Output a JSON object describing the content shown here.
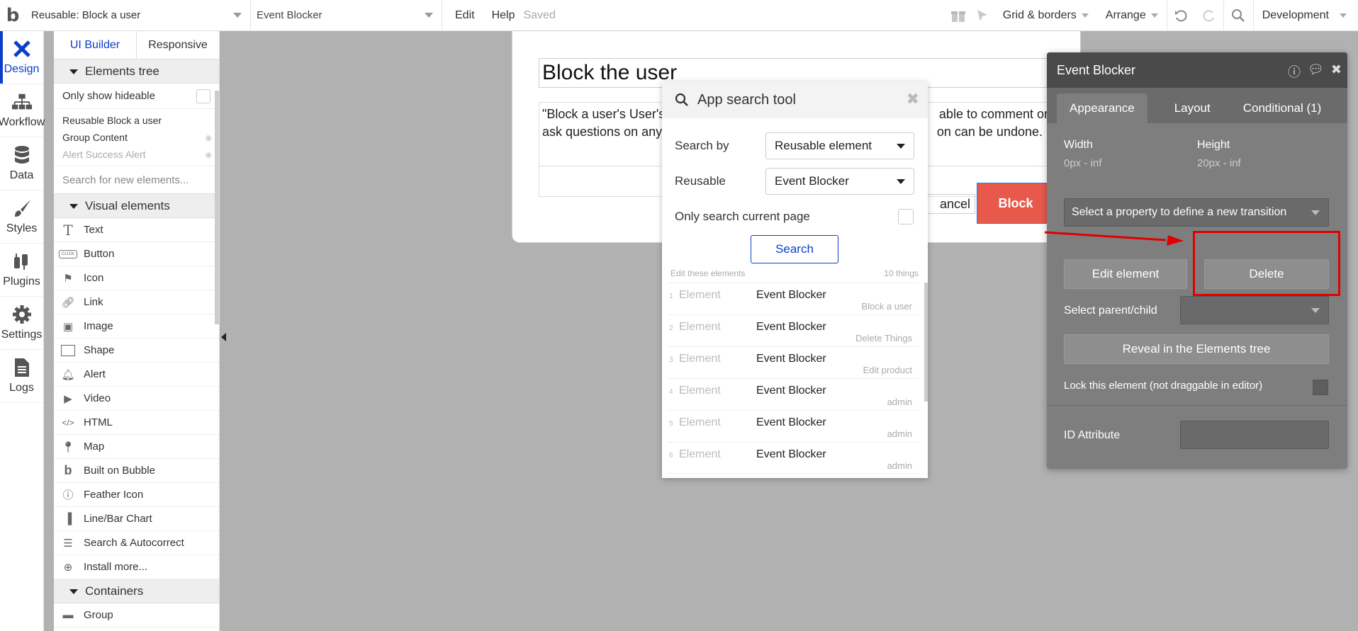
{
  "topbar": {
    "page_select": "Reusable: Block a user",
    "element_select": "Event Blocker",
    "edit": "Edit",
    "help": "Help",
    "saved": "Saved",
    "grid": "Grid & borders",
    "arrange": "Arrange",
    "env": "Development"
  },
  "rail": [
    {
      "label": "Design",
      "icon": "design-icon"
    },
    {
      "label": "Workflow",
      "icon": "workflow-icon"
    },
    {
      "label": "Data",
      "icon": "data-icon"
    },
    {
      "label": "Styles",
      "icon": "styles-icon"
    },
    {
      "label": "Plugins",
      "icon": "plugins-icon"
    },
    {
      "label": "Settings",
      "icon": "settings-icon"
    },
    {
      "label": "Logs",
      "icon": "logs-icon"
    }
  ],
  "panel": {
    "tabs": [
      "UI Builder",
      "Responsive"
    ],
    "tree_header": "Elements tree",
    "only_hideable": "Only show hideable",
    "tree": [
      "Reusable Block a user",
      "Group Content",
      "Alert Success Alert"
    ],
    "search_placeholder": "Search for new elements...",
    "visual_header": "Visual elements",
    "visual": [
      "Text",
      "Button",
      "Icon",
      "Link",
      "Image",
      "Shape",
      "Alert",
      "Video",
      "HTML",
      "Map",
      "Built on Bubble",
      "Feather Icon",
      "Line/Bar Chart",
      "Search & Autocorrect",
      "Install more..."
    ],
    "button_icon_text": "CLICK",
    "containers_header": "Containers",
    "containers": [
      "Group"
    ]
  },
  "canvas": {
    "title": "Block the user",
    "text_line1": "\"Block a user's User's",
    "text_line1_end": "able to comment or",
    "text_line2": "ask questions on any",
    "text_line2_end": "on can be undone.",
    "cancel": "ancel",
    "block": "Block"
  },
  "search_tool": {
    "title": "App search tool",
    "search_by_label": "Search by",
    "search_by_value": "Reusable element",
    "reusable_label": "Reusable",
    "reusable_value": "Event Blocker",
    "only_current": "Only search current page",
    "search_btn": "Search",
    "edit_these": "Edit these elements",
    "count": "10 things",
    "results": [
      {
        "num": "1",
        "kind": "Element",
        "name": "Event Blocker",
        "where": "Block a user"
      },
      {
        "num": "2",
        "kind": "Element",
        "name": "Event Blocker",
        "where": "Delete Things"
      },
      {
        "num": "3",
        "kind": "Element",
        "name": "Event Blocker",
        "where": "Edit product"
      },
      {
        "num": "4",
        "kind": "Element",
        "name": "Event Blocker",
        "where": "admin"
      },
      {
        "num": "5",
        "kind": "Element",
        "name": "Event Blocker",
        "where": "admin"
      },
      {
        "num": "6",
        "kind": "Element",
        "name": "Event Blocker",
        "where": "admin"
      }
    ]
  },
  "prop": {
    "title": "Event Blocker",
    "tabs": [
      "Appearance",
      "Layout",
      "Conditional (1)"
    ],
    "width_label": "Width",
    "width_value": "0px - inf",
    "height_label": "Height",
    "height_value": "20px - inf",
    "transition": "Select a property to define a new transition",
    "edit_element": "Edit element",
    "delete": "Delete",
    "parent_child": "Select parent/child",
    "reveal": "Reveal in the Elements tree",
    "lock": "Lock this element (not draggable in editor)",
    "id_attr": "ID Attribute"
  },
  "colors": {
    "accent": "#0b3ecb",
    "block_button": "#e8594c",
    "annotation": "#e00000"
  }
}
